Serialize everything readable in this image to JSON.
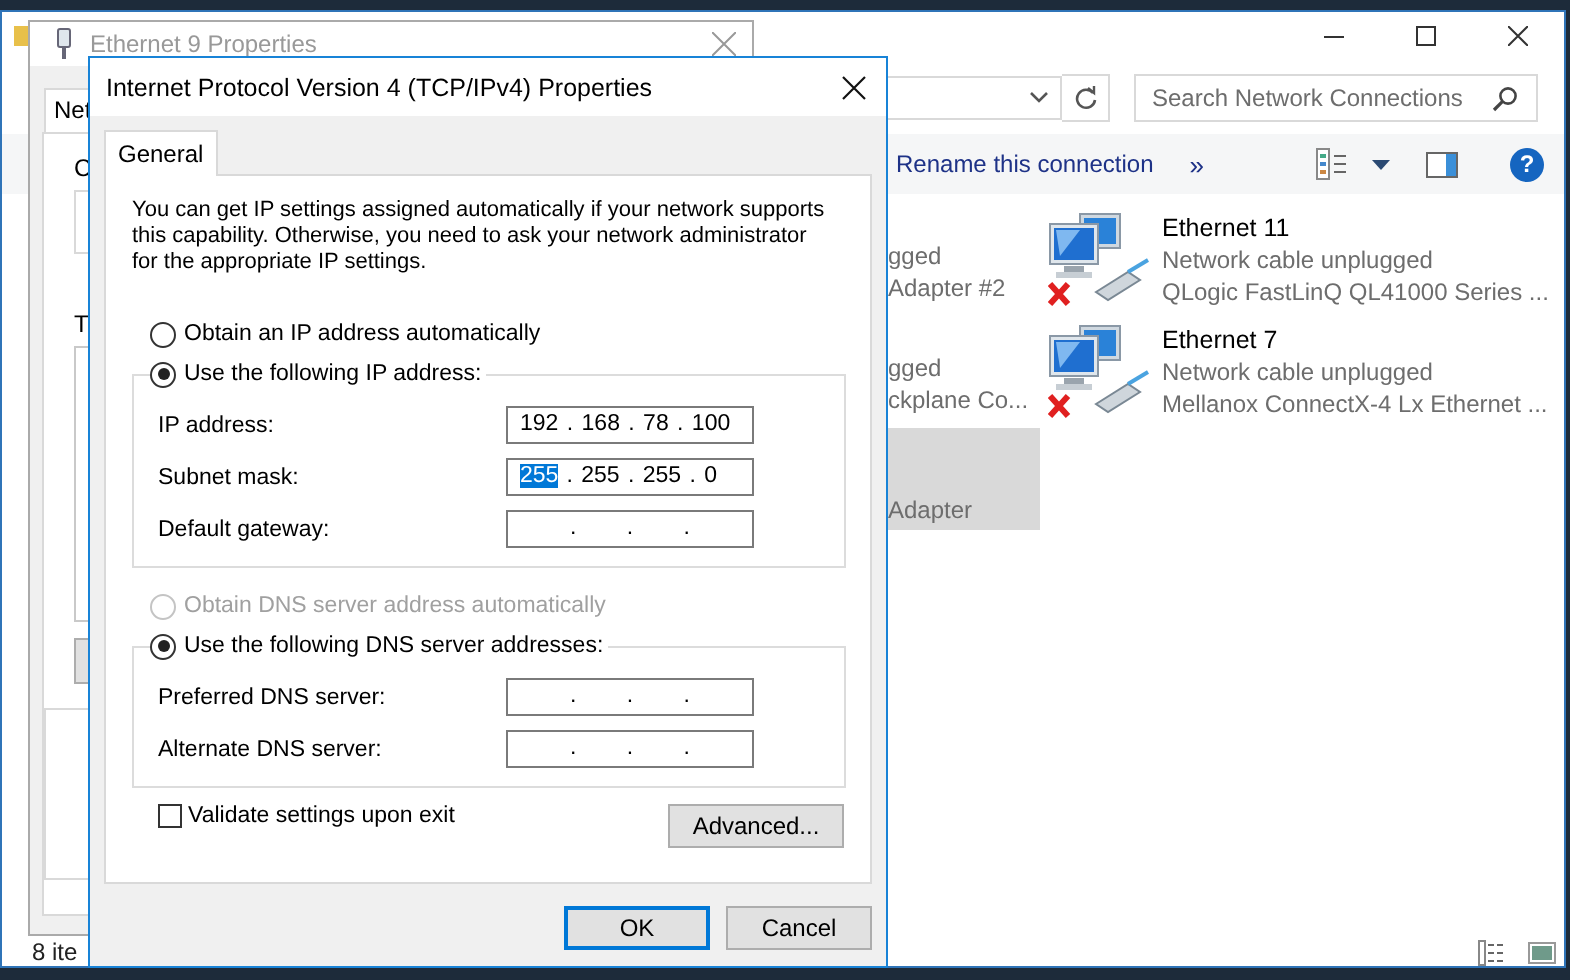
{
  "explorer": {
    "search": {
      "placeholder": "Search Network Connections"
    },
    "toolbar": [
      {
        "kind": "text",
        "label": "Rename this connection"
      },
      {
        "kind": "text",
        "label": "»"
      },
      {
        "kind": "view"
      },
      {
        "kind": "caret"
      },
      {
        "kind": "pane"
      },
      {
        "kind": "help",
        "glyph": "?"
      }
    ],
    "partial_items": [
      {
        "lines": [
          "gged",
          "Adapter #2"
        ],
        "selected": false
      },
      {
        "lines": [
          "gged",
          "ckplane Co..."
        ],
        "selected": false
      },
      {
        "lines": [
          "Adapter"
        ],
        "selected": true
      }
    ],
    "items": [
      {
        "name": "Ethernet 11",
        "status": "Network cable unplugged",
        "adapter": "QLogic FastLinQ QL41000 Series ..."
      },
      {
        "name": "Ethernet 7",
        "status": "Network cable unplugged",
        "adapter": "Mellanox ConnectX-4 Lx Ethernet ..."
      }
    ],
    "status_bar": "8 ite"
  },
  "ethernet_properties": {
    "title": "Ethernet 9 Properties",
    "tab": "Net",
    "labels": [
      "C",
      "T"
    ]
  },
  "ipv4_dialog": {
    "title": "Internet Protocol Version 4 (TCP/IPv4) Properties",
    "tabs": [
      {
        "label": "General",
        "selected": true
      }
    ],
    "intro": "You can get IP settings assigned automatically if your network supports this capability. Otherwise, you need to ask your network administrator for the appropriate IP settings.",
    "ip_options": [
      {
        "label": "Obtain an IP address automatically",
        "selected": false,
        "disabled": false
      },
      {
        "label": "Use the following IP address:",
        "selected": true,
        "disabled": false
      }
    ],
    "ip_fields": [
      {
        "label": "IP address:",
        "value": "192 . 168 . 78 . 100"
      },
      {
        "label": "Subnet mask:",
        "selected_text": "255",
        "unselected_text": ". 255 . 255 . 0"
      },
      {
        "label": "Default gateway:",
        "value": ". . ."
      }
    ],
    "dns_options": [
      {
        "label": "Obtain DNS server address automatically",
        "selected": false,
        "disabled": true
      },
      {
        "label": "Use the following DNS server addresses:",
        "selected": true,
        "disabled": false
      }
    ],
    "dns_fields": [
      {
        "label": "Preferred DNS server:",
        "value": ". . ."
      },
      {
        "label": "Alternate DNS server:",
        "value": ". . ."
      }
    ],
    "validate": {
      "label": "Validate settings upon exit",
      "checked": false
    },
    "advanced_button": "Advanced...",
    "buttons": [
      {
        "label": "OK",
        "default": true
      },
      {
        "label": "Cancel",
        "default": false
      }
    ]
  }
}
